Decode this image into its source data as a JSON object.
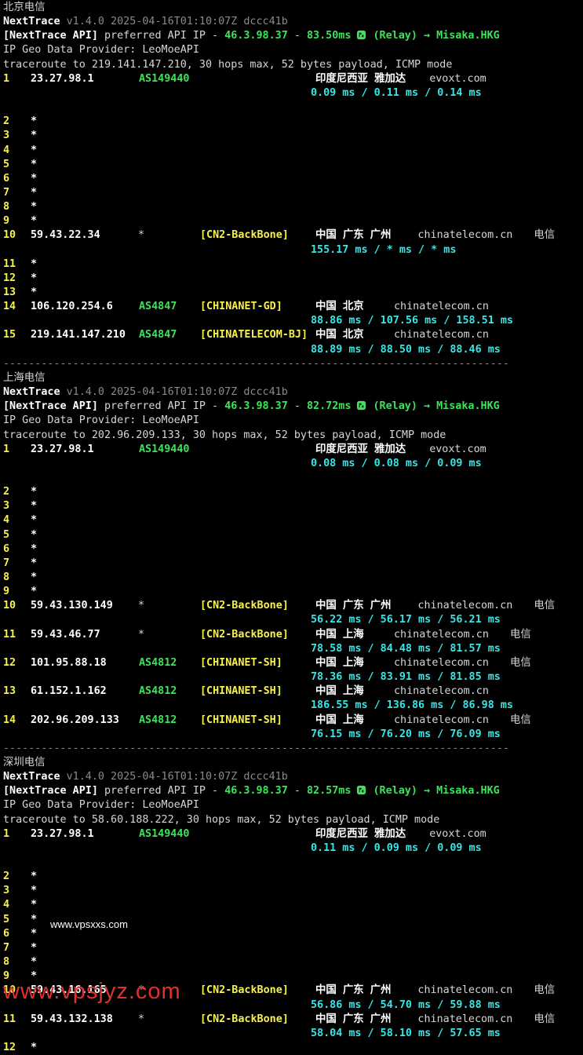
{
  "app": {
    "name": "NextTrace",
    "version": "v1.4.0 2025-04-16T01:10:07Z dccc41b",
    "api_prefix": "[NextTrace API]",
    "api_mid": " preferred API IP - ",
    "api_ip": "46.3.98.37",
    "api_dash": " - ",
    "relay": " (Relay) → Misaka.HKG",
    "geo_line": "IP Geo Data Provider: LeoMoeAPI",
    "separator": "--------------------------------------------------------------------------------"
  },
  "sections": [
    {
      "title": "北京电信",
      "latency": "83.50ms",
      "traceroute": "traceroute to 219.141.147.210, 30 hops max, 52 bytes payload, ICMP mode",
      "hops": [
        {
          "n": "1",
          "ip": "23.27.98.1",
          "as": "AS149440",
          "tag": "",
          "geo": "印度尼西亚 雅加达",
          "domain": "evoxt.com",
          "isp": "",
          "rtt": "0.09 ms / 0.11 ms / 0.14 ms"
        },
        {
          "n": "2",
          "star": "*"
        },
        {
          "n": "3",
          "star": "*"
        },
        {
          "n": "4",
          "star": "*"
        },
        {
          "n": "5",
          "star": "*"
        },
        {
          "n": "6",
          "star": "*"
        },
        {
          "n": "7",
          "star": "*"
        },
        {
          "n": "8",
          "star": "*"
        },
        {
          "n": "9",
          "star": "*"
        },
        {
          "n": "10",
          "ip": "59.43.22.34",
          "as": "*",
          "tag": "[CN2-BackBone]",
          "geo": "中国 广东 广州",
          "domain": "chinatelecom.cn",
          "isp": "电信",
          "rtt": "155.17 ms / * ms / * ms"
        },
        {
          "n": "11",
          "star": "*"
        },
        {
          "n": "12",
          "star": "*"
        },
        {
          "n": "13",
          "star": "*"
        },
        {
          "n": "14",
          "ip": "106.120.254.6",
          "as": "AS4847",
          "tag": "[CHINANET-GD]",
          "geo": "中国 北京",
          "domain": "chinatelecom.cn",
          "isp": "",
          "rtt": "88.86 ms / 107.56 ms / 158.51 ms"
        },
        {
          "n": "15",
          "ip": "219.141.147.210",
          "as": "AS4847",
          "tag": "[CHINATELECOM-BJ]",
          "geo": "中国 北京",
          "domain": "chinatelecom.cn",
          "isp": "",
          "rtt": "88.89 ms / 88.50 ms / 88.46 ms"
        }
      ]
    },
    {
      "title": "上海电信",
      "latency": "82.72ms",
      "traceroute": "traceroute to 202.96.209.133, 30 hops max, 52 bytes payload, ICMP mode",
      "hops": [
        {
          "n": "1",
          "ip": "23.27.98.1",
          "as": "AS149440",
          "tag": "",
          "geo": "印度尼西亚 雅加达",
          "domain": "evoxt.com",
          "isp": "",
          "rtt": "0.08 ms / 0.08 ms / 0.09 ms"
        },
        {
          "n": "2",
          "star": "*"
        },
        {
          "n": "3",
          "star": "*"
        },
        {
          "n": "4",
          "star": "*"
        },
        {
          "n": "5",
          "star": "*"
        },
        {
          "n": "6",
          "star": "*"
        },
        {
          "n": "7",
          "star": "*"
        },
        {
          "n": "8",
          "star": "*"
        },
        {
          "n": "9",
          "star": "*"
        },
        {
          "n": "10",
          "ip": "59.43.130.149",
          "as": "*",
          "tag": "[CN2-BackBone]",
          "geo": "中国 广东 广州",
          "domain": "chinatelecom.cn",
          "isp": "电信",
          "rtt": "56.22 ms / 56.17 ms / 56.21 ms"
        },
        {
          "n": "11",
          "ip": "59.43.46.77",
          "as": "*",
          "tag": "[CN2-BackBone]",
          "geo": "中国 上海",
          "domain": "chinatelecom.cn",
          "isp": "电信",
          "rtt": "78.58 ms / 84.48 ms / 81.57 ms"
        },
        {
          "n": "12",
          "ip": "101.95.88.18",
          "as": "AS4812",
          "tag": "[CHINANET-SH]",
          "geo": "中国 上海",
          "domain": "chinatelecom.cn",
          "isp": "电信",
          "rtt": "78.36 ms / 83.91 ms / 81.85 ms"
        },
        {
          "n": "13",
          "ip": "61.152.1.162",
          "as": "AS4812",
          "tag": "[CHINANET-SH]",
          "geo": "中国 上海",
          "domain": "chinatelecom.cn",
          "isp": "",
          "rtt": "186.55 ms / 136.86 ms / 86.98 ms"
        },
        {
          "n": "14",
          "ip": "202.96.209.133",
          "as": "AS4812",
          "tag": "[CHINANET-SH]",
          "geo": "中国 上海",
          "domain": "chinatelecom.cn",
          "isp": "电信",
          "rtt": "76.15 ms / 76.20 ms / 76.09 ms"
        }
      ]
    },
    {
      "title": "深圳电信",
      "latency": "82.57ms",
      "traceroute": "traceroute to 58.60.188.222, 30 hops max, 52 bytes payload, ICMP mode",
      "hops": [
        {
          "n": "1",
          "ip": "23.27.98.1",
          "as": "AS149440",
          "tag": "",
          "geo": "印度尼西亚 雅加达",
          "domain": "evoxt.com",
          "isp": "",
          "rtt": "0.11 ms / 0.09 ms / 0.09 ms"
        },
        {
          "n": "2",
          "star": "*"
        },
        {
          "n": "3",
          "star": "*"
        },
        {
          "n": "4",
          "star": "*"
        },
        {
          "n": "5",
          "star": "*"
        },
        {
          "n": "6",
          "star": "*"
        },
        {
          "n": "7",
          "star": "*"
        },
        {
          "n": "8",
          "star": "*"
        },
        {
          "n": "9",
          "star": "*"
        },
        {
          "n": "10",
          "ip": "59.43.16.165",
          "as": "*",
          "tag": "[CN2-BackBone]",
          "geo": "中国 广东 广州",
          "domain": "chinatelecom.cn",
          "isp": "电信",
          "rtt": "56.86 ms / 54.70 ms / 59.88 ms"
        },
        {
          "n": "11",
          "ip": "59.43.132.138",
          "as": "*",
          "tag": "[CN2-BackBone]",
          "geo": "中国 广东 广州",
          "domain": "chinatelecom.cn",
          "isp": "电信",
          "rtt": "58.04 ms / 58.10 ms / 57.65 ms"
        },
        {
          "n": "12",
          "star": "*"
        }
      ]
    }
  ],
  "watermarks": {
    "small": "www.vpsxxs.com",
    "large": "www.vpsjyz.com"
  },
  "icons": {
    "relay": "globe-icon"
  }
}
